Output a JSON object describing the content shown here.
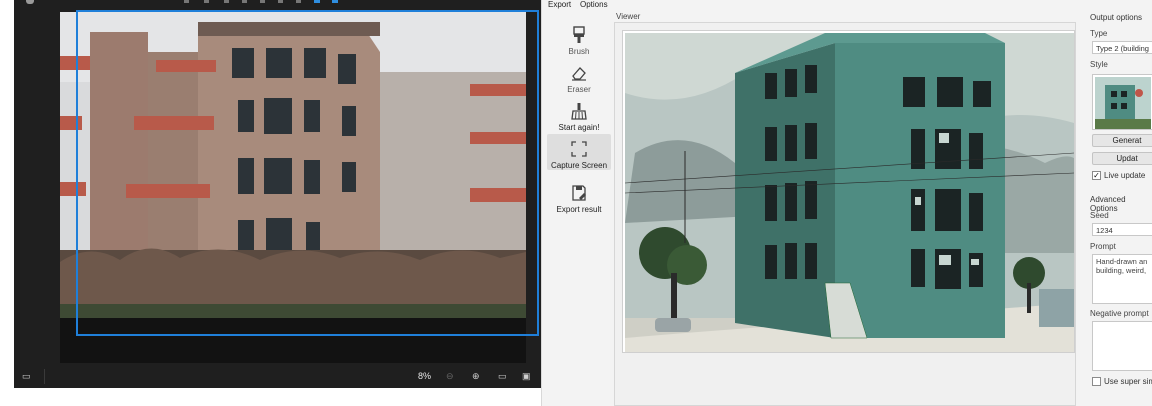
{
  "photo_viewer": {
    "zoom_level": "8%",
    "statusbar": {
      "zoom_out_icon": "zoom-out-icon",
      "zoom_in_icon": "zoom-in-icon",
      "fit_icon": "fit-screen-icon",
      "actual_size_icon": "actual-size-icon"
    }
  },
  "app": {
    "menu": [
      "Export",
      "Options"
    ],
    "toolbar": [
      {
        "label": "Brush",
        "icon": "brush-icon"
      },
      {
        "label": "Eraser",
        "icon": "eraser-icon"
      },
      {
        "label": "Start again!",
        "icon": "broom-icon"
      },
      {
        "label": "Capture Screen",
        "icon": "capture-screen-icon"
      },
      {
        "label": "Export result",
        "icon": "export-icon"
      }
    ],
    "viewer_label": "Viewer",
    "output_options": {
      "title": "Output options",
      "type_label": "Type",
      "type_value": "Type 2 (building",
      "style_label": "Style",
      "generate_button": "Generat",
      "update_button": "Updat",
      "live_update_label": "Live update",
      "live_update_checked": true,
      "advanced_title": "Advanced Options",
      "seed_label": "Seed",
      "seed_value": "1234",
      "prompt_label": "Prompt",
      "prompt_value": "Hand-drawn an building, weird,",
      "negative_prompt_label": "Negative prompt",
      "negative_prompt_value": "",
      "super_sim_label": "Use super sim",
      "super_sim_checked": false
    }
  },
  "colors": {
    "selection": "#1f7fd9",
    "dark_bg": "#1f1f1f",
    "app_bg": "#f3f3f3"
  }
}
